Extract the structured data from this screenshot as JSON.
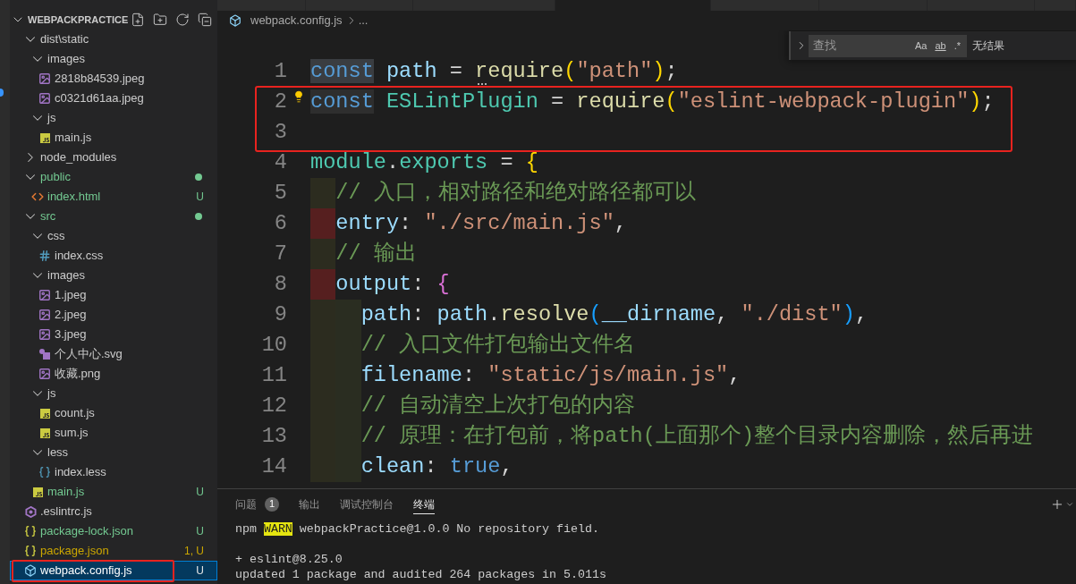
{
  "sidebar": {
    "section": {
      "title": "WEBPACKPRACTICE",
      "expanded": true
    },
    "items": [
      {
        "kind": "folder",
        "name": "dist\\static",
        "expanded": true,
        "selected": false,
        "children": [
          {
            "kind": "folder",
            "name": "images",
            "expanded": true,
            "selected": false,
            "children": [
              {
                "kind": "image",
                "name": "2818b84539.jpeg",
                "selected": false
              },
              {
                "kind": "image",
                "name": "c0321d61aa.jpeg",
                "selected": false
              }
            ]
          },
          {
            "kind": "folder",
            "name": "js",
            "expanded": true,
            "selected": false,
            "children": [
              {
                "kind": "js",
                "name": "main.js",
                "selected": false
              }
            ]
          }
        ]
      },
      {
        "kind": "folder",
        "name": "node_modules",
        "expanded": false,
        "selected": false
      },
      {
        "kind": "folder",
        "name": "public",
        "expanded": true,
        "selected": false,
        "color": "#73c991",
        "children": [
          {
            "kind": "html",
            "name": "index.html",
            "selected": false,
            "color": "#73c991",
            "badge": "U"
          }
        ]
      },
      {
        "kind": "folder",
        "name": "src",
        "expanded": true,
        "selected": false,
        "color": "#73c991",
        "children": [
          {
            "kind": "folder",
            "name": "css",
            "expanded": true,
            "selected": false,
            "children": [
              {
                "kind": "css",
                "name": "index.css",
                "selected": false
              }
            ]
          },
          {
            "kind": "folder",
            "name": "images",
            "expanded": true,
            "selected": false,
            "children": [
              {
                "kind": "image",
                "name": "1.jpeg",
                "selected": false
              },
              {
                "kind": "image",
                "name": "2.jpeg",
                "selected": false
              },
              {
                "kind": "image",
                "name": "3.jpeg",
                "selected": false
              },
              {
                "kind": "svg",
                "name": "个人中心.svg",
                "selected": false
              },
              {
                "kind": "image",
                "name": "收藏.png",
                "selected": false
              }
            ]
          },
          {
            "kind": "folder",
            "name": "js",
            "expanded": true,
            "selected": false,
            "children": [
              {
                "kind": "js",
                "name": "count.js",
                "selected": false
              },
              {
                "kind": "js",
                "name": "sum.js",
                "selected": false
              }
            ]
          },
          {
            "kind": "folder",
            "name": "less",
            "expanded": true,
            "selected": false,
            "children": [
              {
                "kind": "less",
                "name": "index.less",
                "selected": false
              }
            ]
          },
          {
            "kind": "js",
            "name": "main.js",
            "selected": false,
            "color": "#73c991",
            "badge": "U"
          }
        ]
      },
      {
        "kind": "eslint",
        "name": ".eslintrc.js",
        "selected": false
      },
      {
        "kind": "json",
        "name": "package-lock.json",
        "selected": false,
        "color": "#73c991",
        "badge": "U"
      },
      {
        "kind": "json",
        "name": "package.json",
        "selected": false,
        "color": "#cca700",
        "badge": "1, U"
      },
      {
        "kind": "webpack",
        "name": "webpack.config.js",
        "selected": true,
        "badge": "U"
      }
    ]
  },
  "editor_tabs": [
    {
      "selected": false
    },
    {
      "selected": false
    },
    {
      "selected": false
    },
    {
      "selected": true
    },
    {
      "selected": false
    },
    {
      "selected": false
    },
    {
      "selected": false
    },
    {
      "selected": false
    }
  ],
  "breadcrumb": {
    "file": "webpack.config.js",
    "more": "..."
  },
  "find_widget": {
    "placeholder": "查找",
    "options": [
      {
        "label": "Aa",
        "on": false
      },
      {
        "label": "ab",
        "on": false
      },
      {
        "label": ".*",
        "on": false
      }
    ],
    "result": "无结果"
  },
  "editor": {
    "lines": [
      {
        "number": "1",
        "tokens": [
          {
            "kind": "selection",
            "text": "const"
          },
          {
            "kind": "variable",
            "text": " path"
          },
          {
            "kind": "plain",
            "text": " = "
          },
          {
            "kind": "function",
            "text": "require",
            "hint": true
          },
          {
            "kind": "bracket1",
            "text": "("
          },
          {
            "kind": "string",
            "text": "\"path\""
          },
          {
            "kind": "bracket1",
            "text": ")"
          },
          {
            "kind": "plain",
            "text": ";"
          }
        ]
      },
      {
        "number": "2",
        "lightbulb": true,
        "tokens": [
          {
            "kind": "occurrence",
            "text": "const"
          },
          {
            "kind": "class",
            "text": " ESLintPlugin"
          },
          {
            "kind": "plain",
            "text": " = "
          },
          {
            "kind": "function",
            "text": "require"
          },
          {
            "kind": "bracket1",
            "text": "("
          },
          {
            "kind": "string",
            "text": "\"eslint-webpack-plugin\""
          },
          {
            "kind": "bracket1",
            "text": ")"
          },
          {
            "kind": "plain",
            "text": ";"
          }
        ]
      },
      {
        "number": "3"
      },
      {
        "number": "4",
        "tokens": [
          {
            "kind": "class",
            "text": "module"
          },
          {
            "kind": "plain",
            "text": "."
          },
          {
            "kind": "class",
            "text": "exports"
          },
          {
            "kind": "plain",
            "text": " = "
          },
          {
            "kind": "bracket1",
            "text": "{"
          }
        ]
      },
      {
        "number": "5",
        "indent": [
          {
            "color": "#2c2c1f"
          }
        ],
        "tokens": [
          {
            "kind": "comment",
            "text": "// 入口，相对路径和绝对路径都可以"
          }
        ]
      },
      {
        "number": "6",
        "indent": [
          {
            "color": "#561f1f"
          }
        ],
        "tokens": [
          {
            "kind": "property",
            "text": "entry"
          },
          {
            "kind": "plain",
            "text": ": "
          },
          {
            "kind": "string",
            "text": "\"./src/main.js\""
          },
          {
            "kind": "plain",
            "text": ","
          }
        ]
      },
      {
        "number": "7",
        "indent": [
          {
            "color": "#2c2c1f"
          }
        ],
        "tokens": [
          {
            "kind": "comment",
            "text": "// 输出"
          }
        ]
      },
      {
        "number": "8",
        "indent": [
          {
            "color": "#561f1f"
          }
        ],
        "tokens": [
          {
            "kind": "property",
            "text": "output"
          },
          {
            "kind": "plain",
            "text": ": "
          },
          {
            "kind": "bracket2",
            "text": "{"
          }
        ]
      },
      {
        "number": "9",
        "indent": [
          {
            "color": "#2c2c1f"
          },
          {
            "color": "#2a2d21"
          }
        ],
        "tokens": [
          {
            "kind": "property",
            "text": "path"
          },
          {
            "kind": "plain",
            "text": ": "
          },
          {
            "kind": "variable",
            "text": "path"
          },
          {
            "kind": "plain",
            "text": "."
          },
          {
            "kind": "function",
            "text": "resolve"
          },
          {
            "kind": "bracket3",
            "text": "("
          },
          {
            "kind": "variable",
            "text": "__dirname"
          },
          {
            "kind": "plain",
            "text": ", "
          },
          {
            "kind": "string",
            "text": "\"./dist\""
          },
          {
            "kind": "bracket3",
            "text": ")"
          },
          {
            "kind": "plain",
            "text": ","
          }
        ]
      },
      {
        "number": "10",
        "indent": [
          {
            "color": "#2c2c1f"
          },
          {
            "color": "#2a2d21"
          }
        ],
        "tokens": [
          {
            "kind": "comment",
            "text": "// 入口文件打包输出文件名"
          }
        ]
      },
      {
        "number": "11",
        "indent": [
          {
            "color": "#2c2c1f"
          },
          {
            "color": "#2a2d21"
          }
        ],
        "tokens": [
          {
            "kind": "property",
            "text": "filename"
          },
          {
            "kind": "plain",
            "text": ": "
          },
          {
            "kind": "string",
            "text": "\"static/js/main.js\""
          },
          {
            "kind": "plain",
            "text": ","
          }
        ]
      },
      {
        "number": "12",
        "indent": [
          {
            "color": "#2c2c1f"
          },
          {
            "color": "#2a2d21"
          }
        ],
        "tokens": [
          {
            "kind": "comment",
            "text": "// 自动清空上次打包的内容"
          }
        ]
      },
      {
        "number": "13",
        "indent": [
          {
            "color": "#2c2c1f"
          },
          {
            "color": "#2a2d21"
          }
        ],
        "tokens": [
          {
            "kind": "comment",
            "text": "// 原理：在打包前，将path(上面那个)整个目录内容删除，然后再进"
          }
        ]
      },
      {
        "number": "14",
        "indent": [
          {
            "color": "#2c2c1f"
          },
          {
            "color": "#2a2d21"
          }
        ],
        "tokens": [
          {
            "kind": "property",
            "text": "clean"
          },
          {
            "kind": "plain",
            "text": ": "
          },
          {
            "kind": "keyword",
            "text": "true"
          },
          {
            "kind": "plain",
            "text": ","
          }
        ]
      }
    ]
  },
  "panel": {
    "tabs": [
      {
        "label": "问题",
        "count": "1",
        "selected": false
      },
      {
        "label": "输出",
        "selected": false
      },
      {
        "label": "调试控制台",
        "selected": false
      },
      {
        "label": "终端",
        "selected": true
      }
    ],
    "terminal": [
      {
        "kind": "text",
        "spans": [
          {
            "kind": "plain",
            "text": "npm "
          },
          {
            "kind": "warn",
            "text": "WARN"
          },
          {
            "kind": "plain",
            "text": " webpackPractice@1.0.0 No repository field."
          }
        ]
      },
      {
        "kind": "blank"
      },
      {
        "kind": "text",
        "spans": [
          {
            "kind": "plain",
            "text": "+ eslint@8.25.0"
          }
        ]
      },
      {
        "kind": "text",
        "spans": [
          {
            "kind": "plain",
            "text": "updated 1 package and audited 264 packages in 5.011s"
          }
        ]
      }
    ]
  }
}
